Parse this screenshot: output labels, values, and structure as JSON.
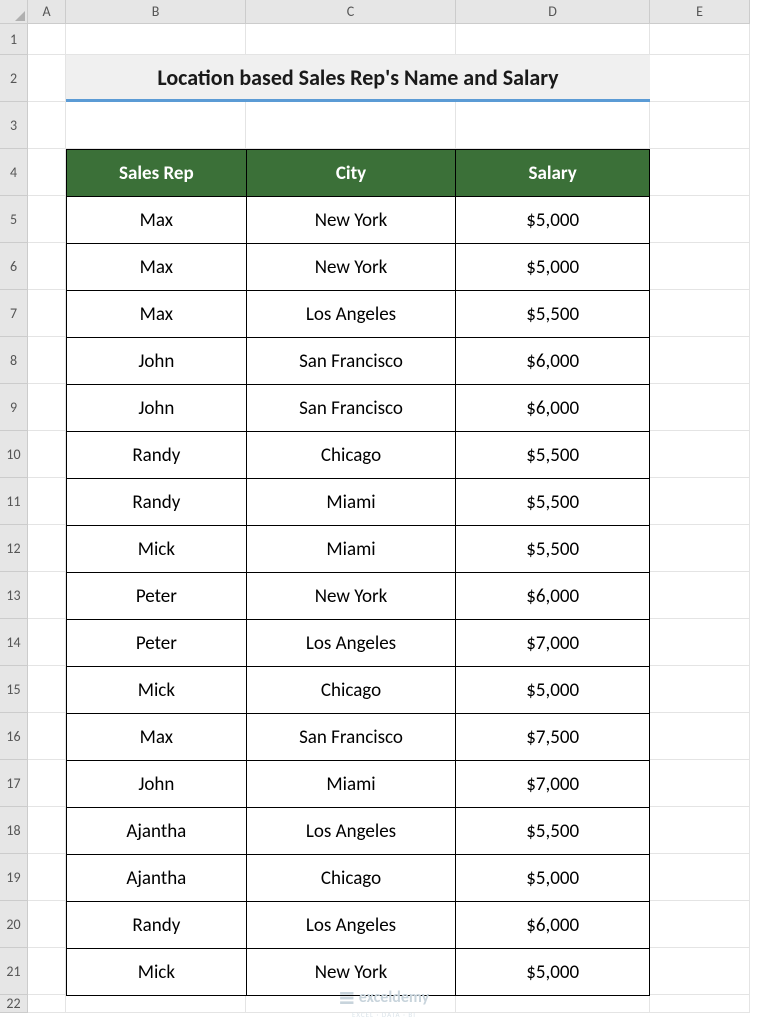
{
  "columns": [
    "A",
    "B",
    "C",
    "D",
    "E"
  ],
  "rows": [
    "1",
    "2",
    "3",
    "4",
    "5",
    "6",
    "7",
    "8",
    "9",
    "10",
    "11",
    "12",
    "13",
    "14",
    "15",
    "16",
    "17",
    "18",
    "19",
    "20",
    "21",
    "22"
  ],
  "title": "Location based Sales Rep's Name and Salary",
  "headers": {
    "rep": "Sales Rep",
    "city": "City",
    "salary": "Salary"
  },
  "data": [
    {
      "rep": "Max",
      "city": "New York",
      "salary": "$5,000"
    },
    {
      "rep": "Max",
      "city": "New York",
      "salary": "$5,000"
    },
    {
      "rep": "Max",
      "city": "Los Angeles",
      "salary": "$5,500"
    },
    {
      "rep": "John",
      "city": "San Francisco",
      "salary": "$6,000"
    },
    {
      "rep": "John",
      "city": "San Francisco",
      "salary": "$6,000"
    },
    {
      "rep": "Randy",
      "city": "Chicago",
      "salary": "$5,500"
    },
    {
      "rep": "Randy",
      "city": "Miami",
      "salary": "$5,500"
    },
    {
      "rep": "Mick",
      "city": "Miami",
      "salary": "$5,500"
    },
    {
      "rep": "Peter",
      "city": "New York",
      "salary": "$6,000"
    },
    {
      "rep": "Peter",
      "city": "Los Angeles",
      "salary": "$7,000"
    },
    {
      "rep": "Mick",
      "city": "Chicago",
      "salary": "$5,000"
    },
    {
      "rep": "Max",
      "city": "San Francisco",
      "salary": "$7,500"
    },
    {
      "rep": "John",
      "city": "Miami",
      "salary": "$7,000"
    },
    {
      "rep": "Ajantha",
      "city": "Los Angeles",
      "salary": "$5,500"
    },
    {
      "rep": "Ajantha",
      "city": "Chicago",
      "salary": "$5,000"
    },
    {
      "rep": "Randy",
      "city": "Los Angeles",
      "salary": "$6,000"
    },
    {
      "rep": "Mick",
      "city": "New York",
      "salary": "$5,000"
    }
  ],
  "watermark": {
    "text": "exceldemy",
    "sub": "EXCEL · DATA · BI"
  }
}
